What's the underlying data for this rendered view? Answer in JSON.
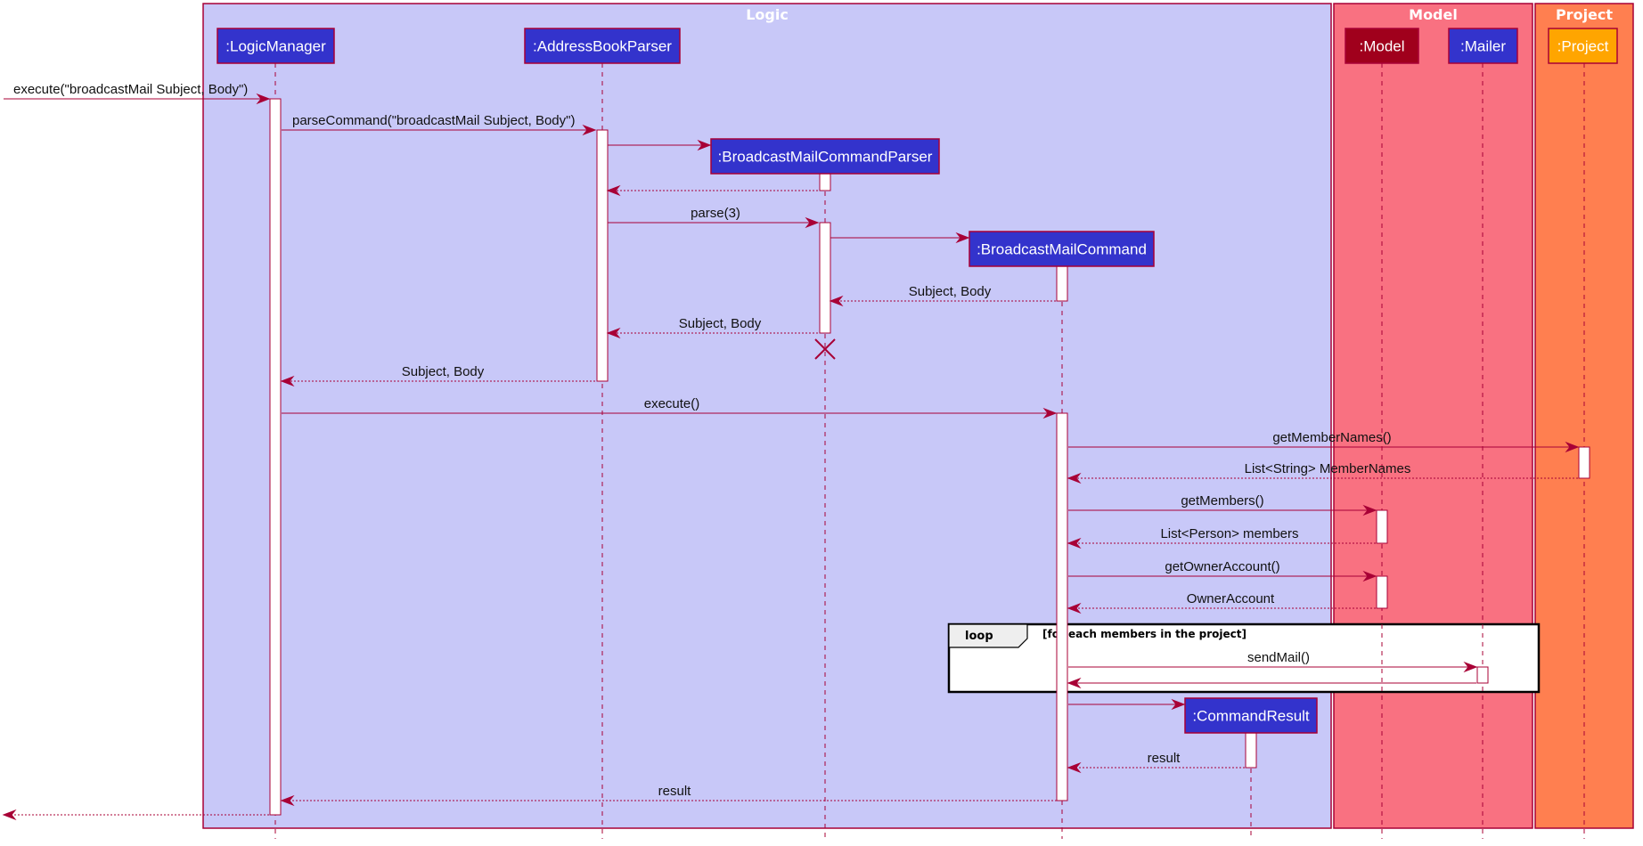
{
  "diagram_type": "UML sequence diagram",
  "colors": {
    "line": "#A80036",
    "participant_default": "#3333CC",
    "participant_model": "#A0001C",
    "participant_project": "#FFA500",
    "frame_logic": "#C8C8F8",
    "frame_model": "#F97181",
    "frame_project": "#FF7F50",
    "activation": "#FFFFFF",
    "loop_fill": "#FFFFFF",
    "loop_tab": "#EEEEEE"
  },
  "frames": [
    {
      "id": "logic",
      "title": "Logic"
    },
    {
      "id": "model",
      "title": "Model"
    },
    {
      "id": "project",
      "title": "Project"
    }
  ],
  "participants": [
    {
      "id": "lm",
      "label": ":LogicManager",
      "frame": "logic",
      "color_key": "participant_default"
    },
    {
      "id": "abp",
      "label": ":AddressBookParser",
      "frame": "logic",
      "color_key": "participant_default"
    },
    {
      "id": "bmcp",
      "label": ":BroadcastMailCommandParser",
      "frame": "logic",
      "color_key": "participant_default",
      "created": true,
      "destroyed": true
    },
    {
      "id": "bmc",
      "label": ":BroadcastMailCommand",
      "frame": "logic",
      "color_key": "participant_default",
      "created": true
    },
    {
      "id": "cr",
      "label": ":CommandResult",
      "frame": "logic",
      "color_key": "participant_default",
      "created": true
    },
    {
      "id": "model",
      "label": ":Model",
      "frame": "model",
      "color_key": "participant_model"
    },
    {
      "id": "mailer",
      "label": ":Mailer",
      "frame": "model",
      "color_key": "participant_default"
    },
    {
      "id": "project",
      "label": ":Project",
      "frame": "project",
      "color_key": "participant_project"
    }
  ],
  "messages": [
    {
      "from": "external",
      "to": "lm",
      "label": "execute(\"broadcastMail Subject, Body\")",
      "kind": "call"
    },
    {
      "from": "lm",
      "to": "abp",
      "label": "parseCommand(\"broadcastMail Subject, Body\")",
      "kind": "call"
    },
    {
      "from": "abp",
      "to": "bmcp",
      "label": "",
      "kind": "create"
    },
    {
      "from": "bmcp",
      "to": "abp",
      "label": "",
      "kind": "return"
    },
    {
      "from": "abp",
      "to": "bmcp",
      "label": "parse(3)",
      "kind": "call"
    },
    {
      "from": "bmcp",
      "to": "bmc",
      "label": "",
      "kind": "create"
    },
    {
      "from": "bmc",
      "to": "bmcp",
      "label": "Subject, Body",
      "kind": "return"
    },
    {
      "from": "bmcp",
      "to": "abp",
      "label": "Subject, Body",
      "kind": "return"
    },
    {
      "from": "abp",
      "to": "lm",
      "label": "Subject, Body",
      "kind": "return"
    },
    {
      "from": "lm",
      "to": "bmc",
      "label": "execute()",
      "kind": "call"
    },
    {
      "from": "bmc",
      "to": "project",
      "label": "getMemberNames()",
      "kind": "call"
    },
    {
      "from": "project",
      "to": "bmc",
      "label": "List<String> MemberNames",
      "kind": "return"
    },
    {
      "from": "bmc",
      "to": "model",
      "label": "getMembers()",
      "kind": "call"
    },
    {
      "from": "model",
      "to": "bmc",
      "label": "List<Person> members",
      "kind": "return"
    },
    {
      "from": "bmc",
      "to": "model",
      "label": "getOwnerAccount()",
      "kind": "call"
    },
    {
      "from": "model",
      "to": "bmc",
      "label": "OwnerAccount",
      "kind": "return"
    },
    {
      "from": "bmc",
      "to": "mailer",
      "label": "sendMail()",
      "kind": "call"
    },
    {
      "from": "mailer",
      "to": "bmc",
      "label": "",
      "kind": "reply"
    },
    {
      "from": "bmc",
      "to": "cr",
      "label": "",
      "kind": "create"
    },
    {
      "from": "cr",
      "to": "bmc",
      "label": "result",
      "kind": "return"
    },
    {
      "from": "bmc",
      "to": "lm",
      "label": "result",
      "kind": "return"
    },
    {
      "from": "lm",
      "to": "external",
      "label": "",
      "kind": "return"
    }
  ],
  "loop": {
    "keyword": "loop",
    "guard": "[for each members in the project]"
  }
}
